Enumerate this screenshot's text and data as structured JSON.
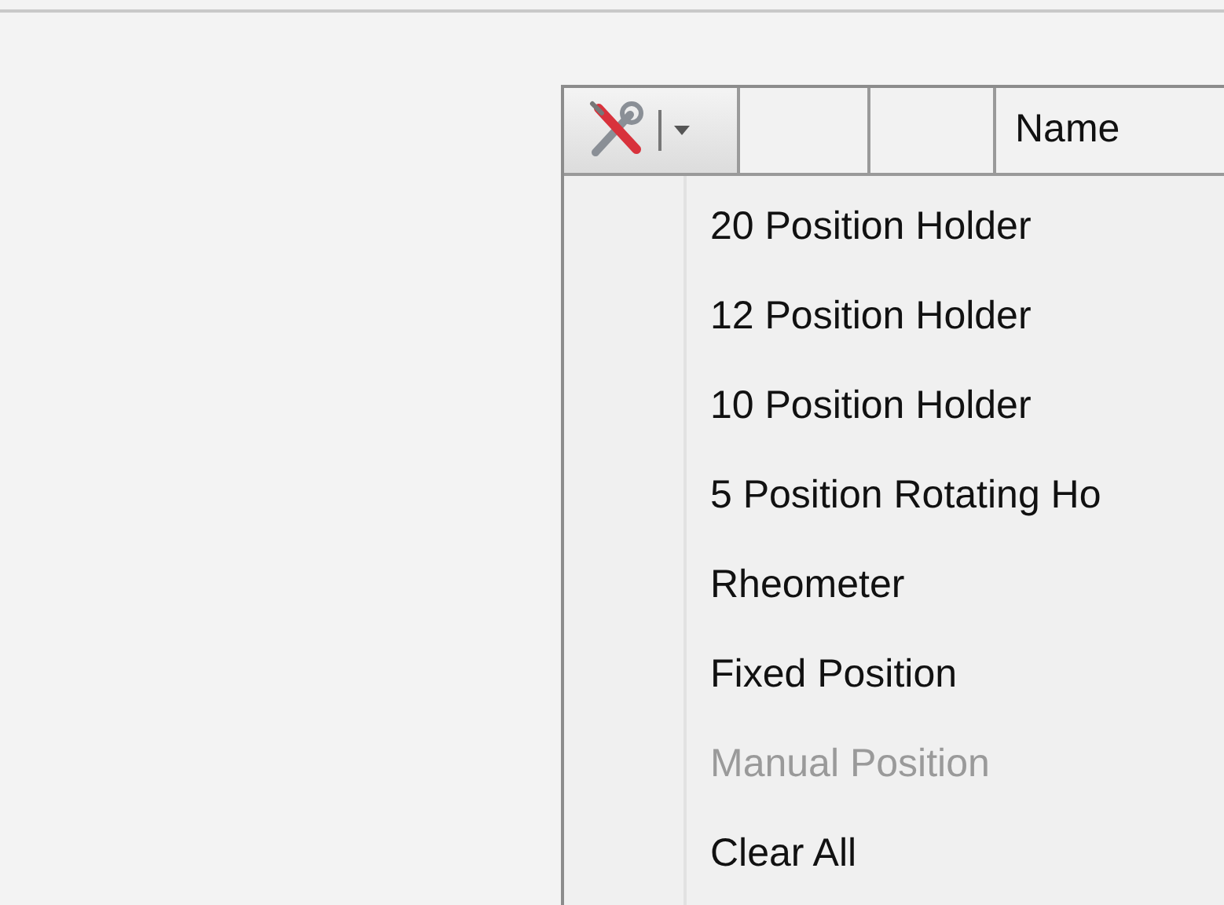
{
  "table": {
    "name_column": "Name"
  },
  "menu": {
    "items": [
      {
        "label": "20 Position Holder",
        "disabled": false
      },
      {
        "label": "12 Position Holder",
        "disabled": false
      },
      {
        "label": "10 Position Holder",
        "disabled": false
      },
      {
        "label": "5 Position Rotating Ho",
        "disabled": false
      },
      {
        "label": "Rheometer",
        "disabled": false
      },
      {
        "label": "Fixed Position",
        "disabled": false
      },
      {
        "label": "Manual Position",
        "disabled": true
      },
      {
        "label": "Clear All",
        "disabled": false
      }
    ]
  }
}
